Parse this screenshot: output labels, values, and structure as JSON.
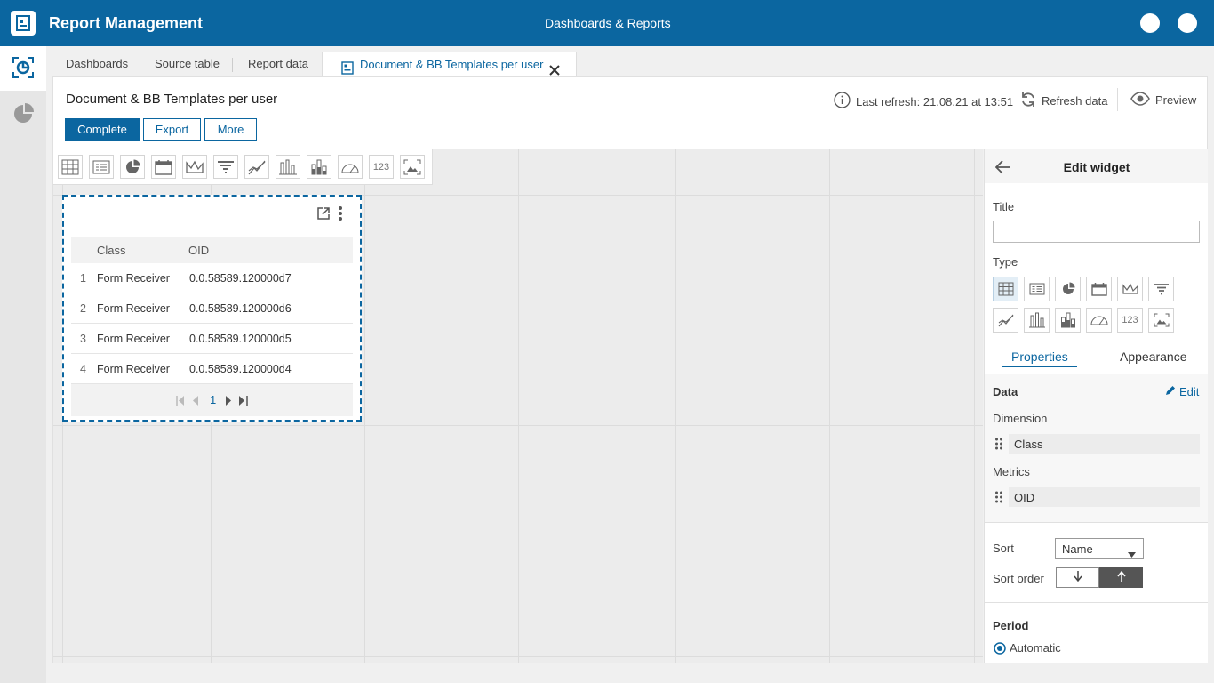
{
  "header": {
    "app_title": "Report Management",
    "center_title": "Dashboards & Reports"
  },
  "rail": {
    "items": [
      {
        "icon": "dashboard-icon"
      },
      {
        "icon": "pie-chart-icon"
      }
    ]
  },
  "tabs": [
    {
      "label": "Dashboards"
    },
    {
      "label": "Source table"
    },
    {
      "label": "Report data"
    },
    {
      "label": "Document & BB Templates per user",
      "icon": "report-icon",
      "active": true
    }
  ],
  "page": {
    "title": "Document & BB Templates per user",
    "buttons": {
      "complete": "Complete",
      "export": "Export",
      "more": "More"
    },
    "last_refresh": "Last refresh: 21.08.21 at 13:51",
    "refresh": "Refresh data",
    "preview": "Preview"
  },
  "widget": {
    "columns": [
      "Class",
      "OID"
    ],
    "rows": [
      {
        "num": "1",
        "class": "Form Receiver",
        "oid": "0.0.58589.120000d7"
      },
      {
        "num": "2",
        "class": "Form Receiver",
        "oid": "0.0.58589.120000d6"
      },
      {
        "num": "3",
        "class": "Form Receiver",
        "oid": "0.0.58589.120000d5"
      },
      {
        "num": "4",
        "class": "Form Receiver",
        "oid": "0.0.58589.120000d4"
      }
    ],
    "page": "1"
  },
  "palette_number_label": "123",
  "side": {
    "title": "Edit widget",
    "title_label": "Title",
    "title_value": "",
    "type_label": "Type",
    "type_number_label": "123",
    "tabs": {
      "properties": "Properties",
      "appearance": "Appearance"
    },
    "data_label": "Data",
    "edit": "Edit",
    "dimension_label": "Dimension",
    "dimension": "Class",
    "metrics_label": "Metrics",
    "metric": "OID",
    "sort_label": "Sort",
    "sort_value": "Name",
    "sort_order_label": "Sort order",
    "period_label": "Period",
    "period_option": "Automatic"
  },
  "colors": {
    "brand": "#0b66a0"
  }
}
